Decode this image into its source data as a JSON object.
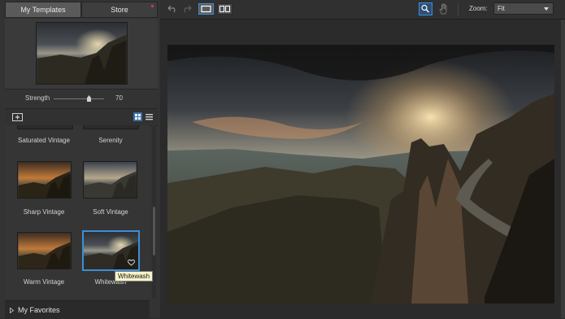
{
  "tabs": {
    "my_templates": "My Templates",
    "store": "Store"
  },
  "strength": {
    "label": "Strength",
    "value": "70",
    "level": 0.7
  },
  "templates": [
    {
      "label": "Saturated Vintage"
    },
    {
      "label": "Serenity"
    },
    {
      "label": "Sharp Vintage"
    },
    {
      "label": "Soft Vintage"
    },
    {
      "label": "Warm Vintage"
    },
    {
      "label": "Whitewash",
      "selected": true
    }
  ],
  "tooltip": "Whitewash",
  "favorites": {
    "label": "My Favorites"
  },
  "zoom": {
    "label": "Zoom:",
    "value": "Fit"
  },
  "colors": {
    "accent": "#3a8fd8",
    "panel": "#333334"
  },
  "icons": [
    "undo-icon",
    "redo-icon",
    "single-view-icon",
    "split-view-icon",
    "magnifier-icon",
    "hand-icon",
    "add-folder-icon",
    "grid-view-icon",
    "list-view-icon",
    "heart-icon",
    "chevron-right-icon"
  ]
}
